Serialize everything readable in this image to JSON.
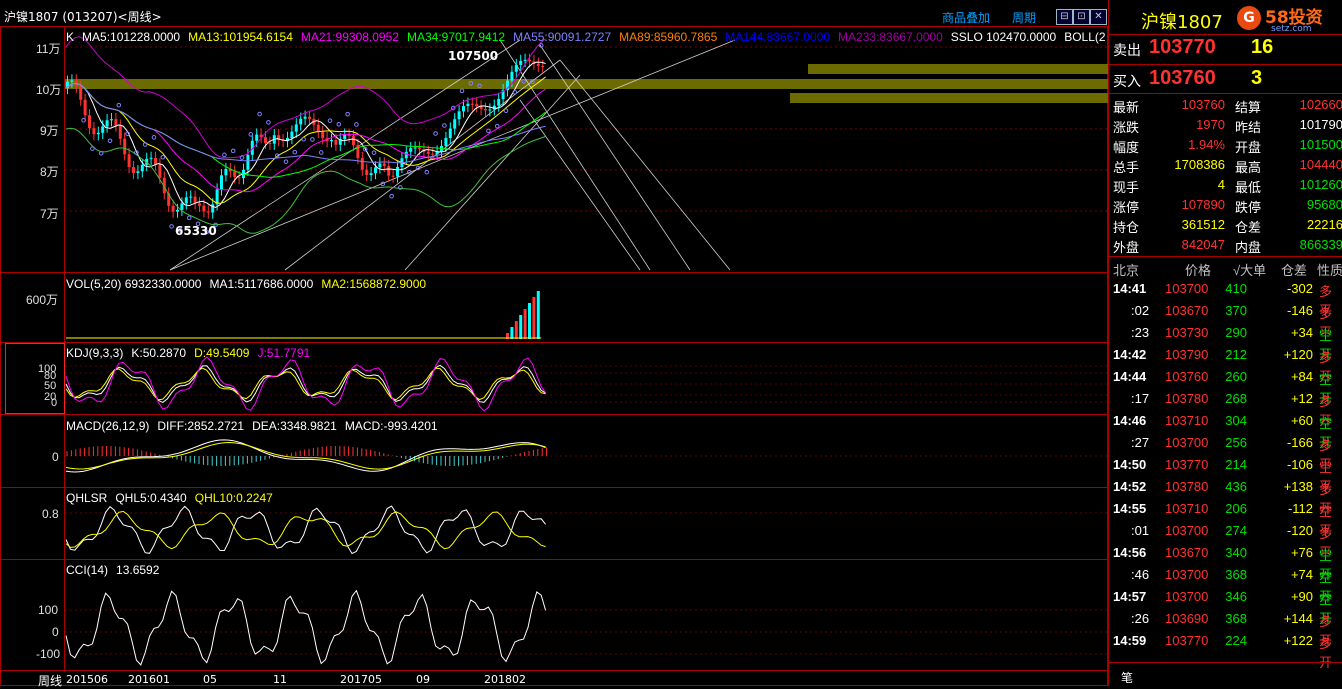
{
  "window": {
    "title": "沪镍1807 (013207)<周线>",
    "toolbar": {
      "overlay": "商品叠加",
      "period": "周期"
    },
    "buttons": [
      "⊟",
      "⊡",
      "✕"
    ]
  },
  "main_pane": {
    "legend": [
      {
        "label": "K",
        "color": "#ffffff"
      },
      {
        "label": "MA5:101228.0000",
        "color": "#ffffff"
      },
      {
        "label": "MA13:101954.6154",
        "color": "#ffff00"
      },
      {
        "label": "MA21:99308.0952",
        "color": "#ff00ff"
      },
      {
        "label": "MA34:97017.9412",
        "color": "#00ff00"
      },
      {
        "label": "MA55:90091.2727",
        "color": "#8080ff"
      },
      {
        "label": "MA89:85960.7865",
        "color": "#ff8000"
      },
      {
        "label": "MA144:83667.0000",
        "color": "#0000ff"
      },
      {
        "label": "MA233:83667.0000",
        "color": "#a000a0"
      },
      {
        "label": "SSLO 102470.0000",
        "color": "#ffffff"
      },
      {
        "label": "BOLL(2",
        "color": "#ffffff"
      }
    ],
    "y_labels": [
      "11万",
      "10万",
      "9万",
      "8万",
      "7万"
    ],
    "annotations": {
      "high": "107500",
      "low": "65330"
    }
  },
  "vol_pane": {
    "header": [
      {
        "label": "VOL(5,20) 6932330.0000",
        "color": "#ffffff"
      },
      {
        "label": "MA1:5117686.0000",
        "color": "#ffffff"
      },
      {
        "label": "MA2:1568872.9000",
        "color": "#ffff00"
      }
    ],
    "y_labels": [
      "600万"
    ]
  },
  "kdj_pane": {
    "header": [
      {
        "label": "KDJ(9,3,3)",
        "color": "#ffffff"
      },
      {
        "label": "K:50.2870",
        "color": "#ffffff"
      },
      {
        "label": "D:49.5409",
        "color": "#ffff00"
      },
      {
        "label": "J:51.7791",
        "color": "#ff00ff"
      }
    ],
    "y_labels": [
      "100",
      "80",
      "50",
      "20",
      "0"
    ]
  },
  "macd_pane": {
    "header": [
      {
        "label": "MACD(26,12,9)",
        "color": "#ffffff"
      },
      {
        "label": "DIFF:2852.2721",
        "color": "#ffffff"
      },
      {
        "label": "DEA:3348.9821",
        "color": "#ffffff"
      },
      {
        "label": "MACD:-993.4201",
        "color": "#ffffff"
      }
    ],
    "y_labels": [
      "0"
    ]
  },
  "qhlsr_pane": {
    "header": [
      {
        "label": "QHLSR",
        "color": "#ffffff"
      },
      {
        "label": "QHL5:0.4340",
        "color": "#ffffff"
      },
      {
        "label": "QHL10:0.2247",
        "color": "#ffff00"
      }
    ],
    "y_labels": [
      "0.8"
    ]
  },
  "cci_pane": {
    "header": [
      {
        "label": "CCI(14)",
        "color": "#ffffff"
      },
      {
        "label": "13.6592",
        "color": "#ffffff"
      }
    ],
    "y_labels": [
      "100",
      "0",
      "-100"
    ]
  },
  "x_axis": {
    "period_label": "周线",
    "labels": [
      "201506",
      "201601",
      "05",
      "11",
      "201705",
      "09",
      "201802"
    ]
  },
  "quote": {
    "symbol": "沪镍1807",
    "logo_text": "58投资",
    "logo_sub": "setz.com",
    "ask_label": "卖出",
    "ask_price": "103770",
    "ask_vol": "16",
    "bid_label": "买入",
    "bid_price": "103760",
    "bid_vol": "3",
    "fields": [
      {
        "l1": "最新",
        "v1": "103760",
        "c1": "red",
        "l2": "结算",
        "v2": "102660",
        "c2": "red"
      },
      {
        "l1": "涨跌",
        "v1": "1970",
        "c1": "red",
        "l2": "昨结",
        "v2": "101790",
        "c2": "white"
      },
      {
        "l1": "幅度",
        "v1": "1.94%",
        "c1": "red",
        "l2": "开盘",
        "v2": "101500",
        "c2": "green"
      },
      {
        "l1": "总手",
        "v1": "1708386",
        "c1": "yellow",
        "l2": "最高",
        "v2": "104440",
        "c2": "red"
      },
      {
        "l1": "现手",
        "v1": "4",
        "c1": "yellow",
        "l2": "最低",
        "v2": "101260",
        "c2": "green"
      },
      {
        "l1": "涨停",
        "v1": "107890",
        "c1": "red",
        "l2": "跌停",
        "v2": "95680",
        "c2": "green"
      },
      {
        "l1": "持仓",
        "v1": "361512",
        "c1": "yellow",
        "l2": "仓差",
        "v2": "22216",
        "c2": "yellow"
      },
      {
        "l1": "外盘",
        "v1": "842047",
        "c1": "red",
        "l2": "内盘",
        "v2": "866339",
        "c2": "green"
      }
    ],
    "tick_header": {
      "place": "北京",
      "price": "价格",
      "big": "√大单",
      "oi": "仓差",
      "nature": "性质"
    },
    "ticks": [
      {
        "time": "14:41",
        "price": "103700",
        "vol": "410",
        "oi": "-302",
        "nature": "多平",
        "pc": "red",
        "nc": "red"
      },
      {
        "time": ":02",
        "price": "103670",
        "vol": "370",
        "oi": "-146",
        "nature": "多平",
        "pc": "red",
        "nc": "red"
      },
      {
        "time": ":23",
        "price": "103730",
        "vol": "290",
        "oi": "+34",
        "nature": "空开",
        "pc": "red",
        "nc": "green"
      },
      {
        "time": "14:42",
        "price": "103790",
        "vol": "212",
        "oi": "+120",
        "nature": "多开",
        "pc": "red",
        "nc": "red"
      },
      {
        "time": "14:44",
        "price": "103760",
        "vol": "260",
        "oi": "+84",
        "nature": "空开",
        "pc": "red",
        "nc": "green"
      },
      {
        "time": ":17",
        "price": "103780",
        "vol": "268",
        "oi": "+12",
        "nature": "多开",
        "pc": "red",
        "nc": "red"
      },
      {
        "time": "14:46",
        "price": "103710",
        "vol": "304",
        "oi": "+60",
        "nature": "空开",
        "pc": "red",
        "nc": "green"
      },
      {
        "time": ":27",
        "price": "103700",
        "vol": "256",
        "oi": "-166",
        "nature": "多平",
        "pc": "red",
        "nc": "red"
      },
      {
        "time": "14:50",
        "price": "103770",
        "vol": "214",
        "oi": "-106",
        "nature": "空平",
        "pc": "red",
        "nc": "red"
      },
      {
        "time": "14:52",
        "price": "103780",
        "vol": "436",
        "oi": "+138",
        "nature": "多开",
        "pc": "red",
        "nc": "red"
      },
      {
        "time": "14:55",
        "price": "103710",
        "vol": "206",
        "oi": "-112",
        "nature": "空平",
        "pc": "red",
        "nc": "red"
      },
      {
        "time": ":01",
        "price": "103700",
        "vol": "274",
        "oi": "-120",
        "nature": "多平",
        "pc": "red",
        "nc": "red"
      },
      {
        "time": "14:56",
        "price": "103670",
        "vol": "340",
        "oi": "+76",
        "nature": "空开",
        "pc": "red",
        "nc": "green"
      },
      {
        "time": ":46",
        "price": "103700",
        "vol": "368",
        "oi": "+74",
        "nature": "空开",
        "pc": "red",
        "nc": "green"
      },
      {
        "time": "14:57",
        "price": "103700",
        "vol": "346",
        "oi": "+90",
        "nature": "空开",
        "pc": "red",
        "nc": "green"
      },
      {
        "time": ":26",
        "price": "103690",
        "vol": "368",
        "oi": "+144",
        "nature": "多开",
        "pc": "red",
        "nc": "red"
      },
      {
        "time": "14:59",
        "price": "103770",
        "vol": "224",
        "oi": "+122",
        "nature": "多开",
        "pc": "red",
        "nc": "red"
      }
    ],
    "bottom_tab": "笔"
  },
  "colors": {
    "frame": "#aa0000",
    "up": "#00ffff",
    "down": "#ff3232",
    "band": "#6b6b00"
  }
}
